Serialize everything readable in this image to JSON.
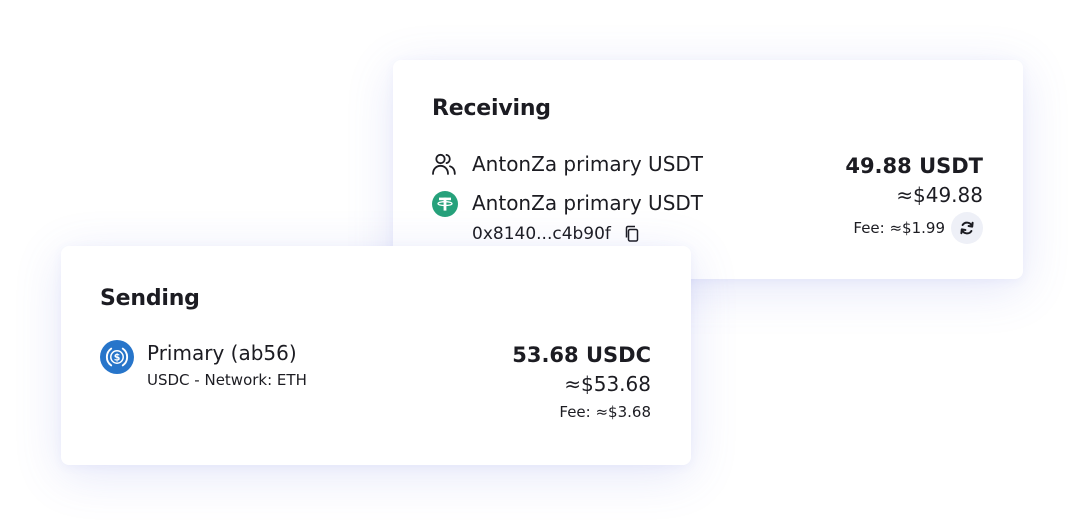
{
  "receiving": {
    "title": "Receiving",
    "contact_name": "AntonZa primary USDT",
    "wallet_name": "AntonZa primary USDT",
    "address": "0x8140...c4b90f",
    "amount": "49.88 USDT",
    "amount_usd": "≈$49.88",
    "fee": "Fee: ≈$1.99",
    "icons": {
      "contact": "users-icon",
      "token": "tether-icon",
      "copy": "copy-icon",
      "refresh": "refresh-icon"
    }
  },
  "sending": {
    "title": "Sending",
    "wallet_name": "Primary (ab56)",
    "network": "USDC - Network: ETH",
    "amount": "53.68 USDC",
    "amount_usd": "≈$53.68",
    "fee": "Fee: ≈$3.68",
    "icons": {
      "token": "usdc-icon"
    }
  },
  "colors": {
    "tether": "#26a17b",
    "usdc": "#2775ca",
    "text": "#1c1c22",
    "refresh_bg": "#eef0f7"
  }
}
